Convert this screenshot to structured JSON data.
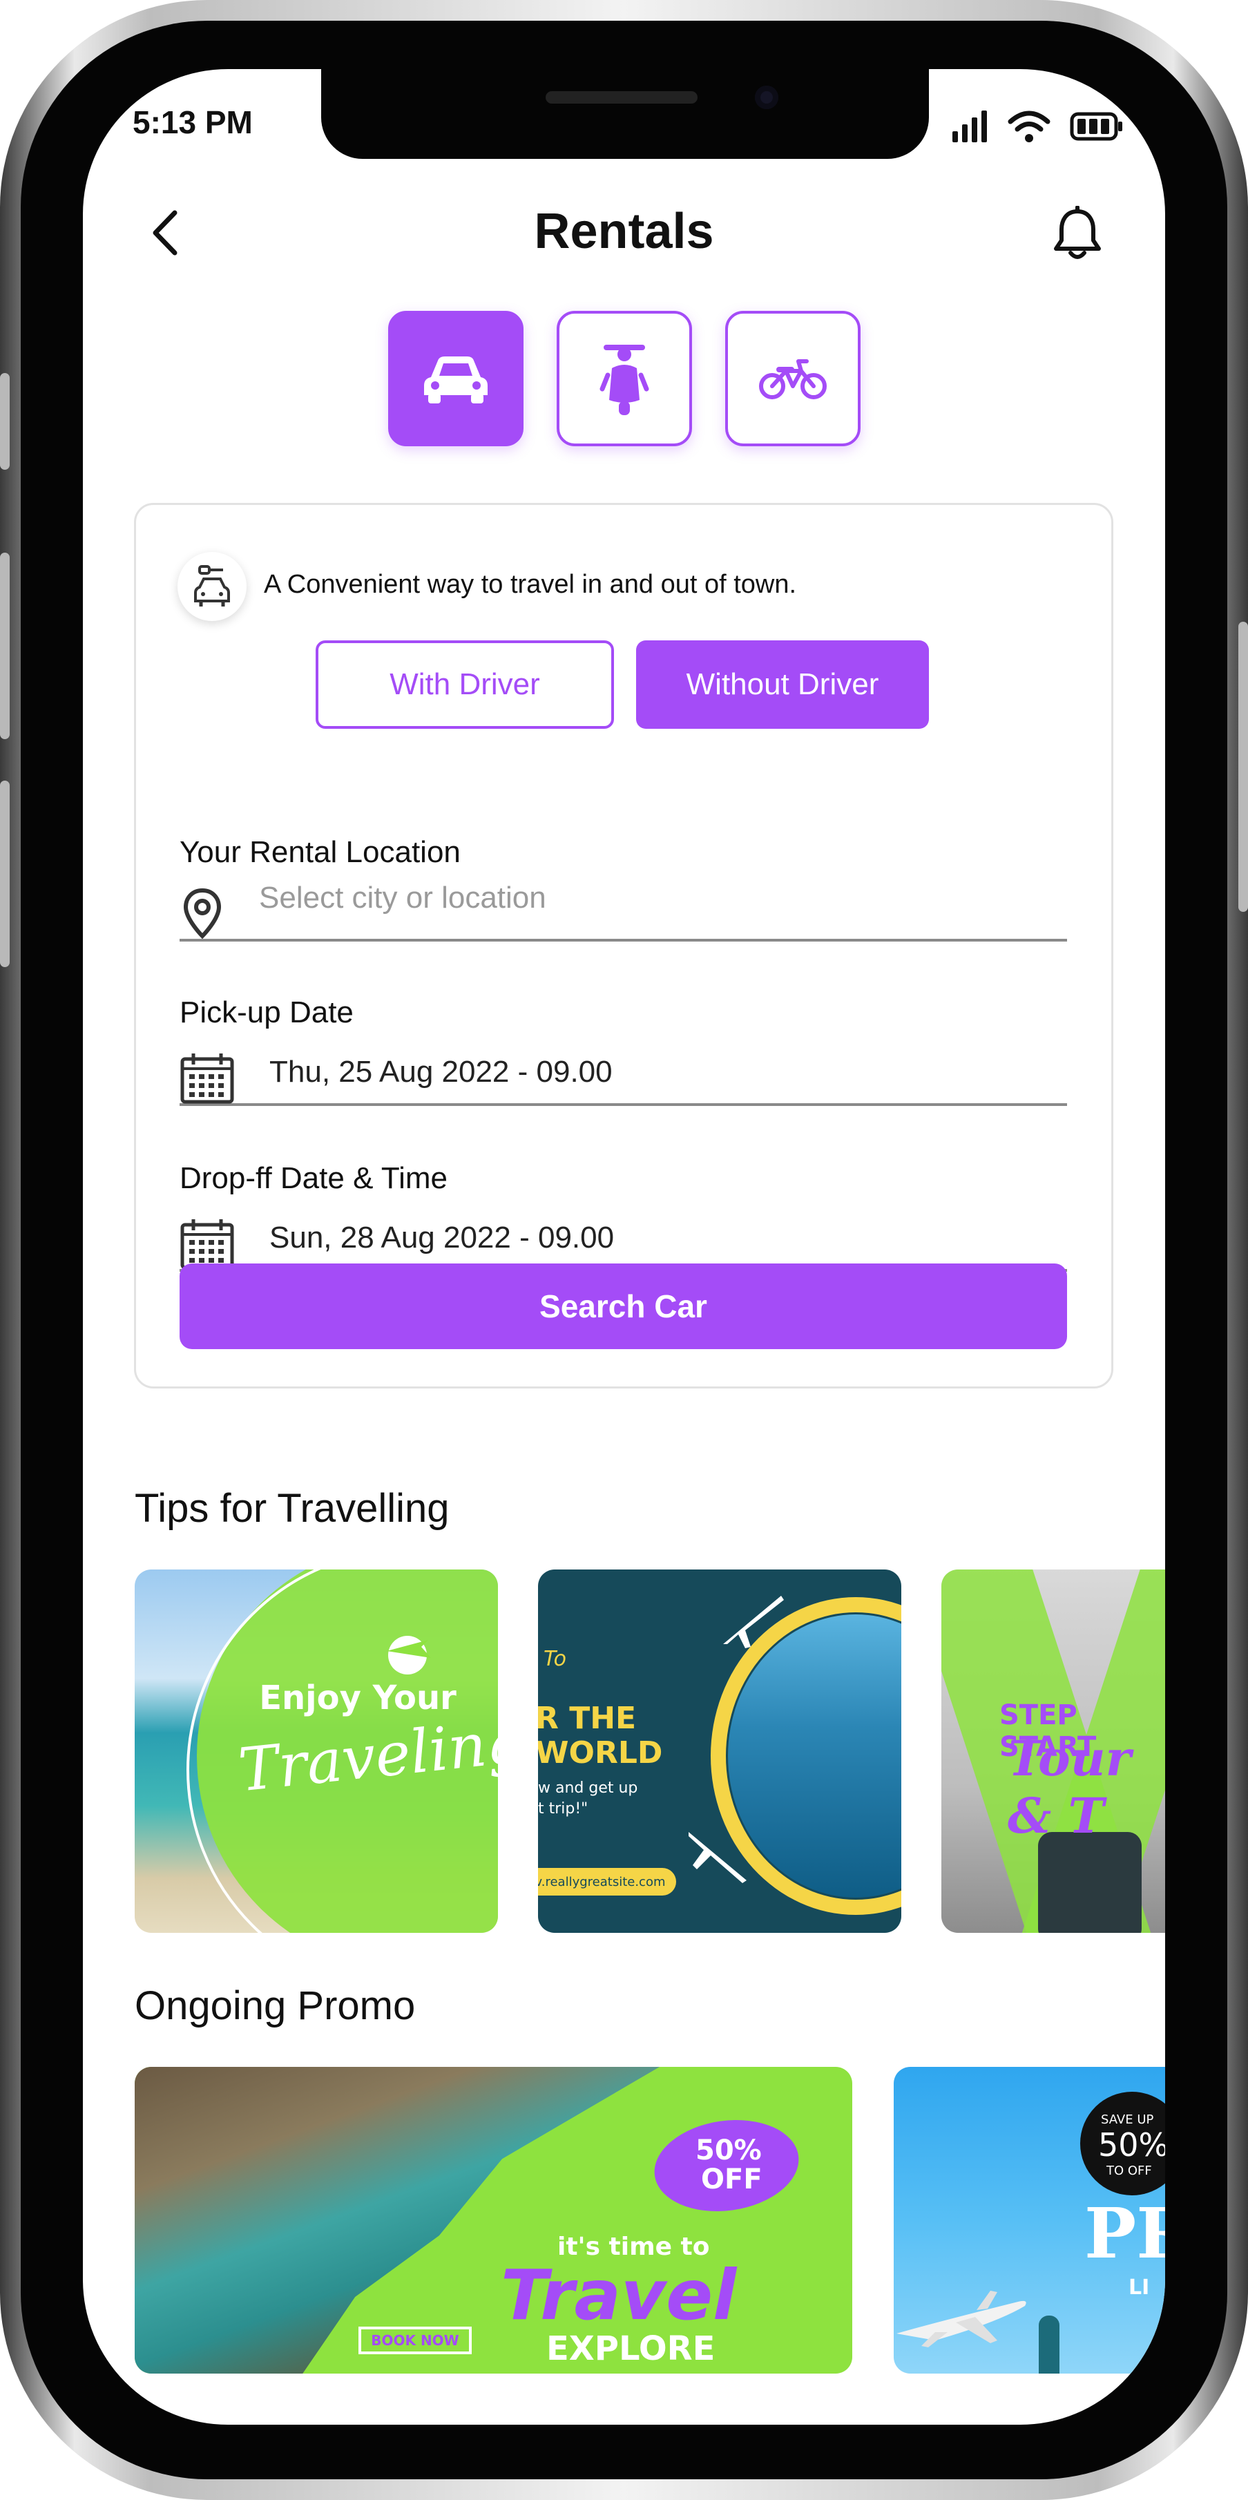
{
  "status_bar": {
    "time": "5:13 PM"
  },
  "header": {
    "title": "Rentals"
  },
  "vehicle_tabs": [
    {
      "name": "car",
      "icon": "car-icon",
      "active": true
    },
    {
      "name": "scooter",
      "icon": "scooter-icon",
      "active": false
    },
    {
      "name": "motorbike",
      "icon": "motorbike-icon",
      "active": false
    }
  ],
  "rental_card": {
    "tagline": "A Convenient way to travel in and out of town.",
    "mode_with_driver": "With Driver",
    "mode_without_driver": "Without Driver",
    "selected_mode": "Without Driver",
    "location_label": "Your Rental Location",
    "location_placeholder": "Select city or location",
    "pickup_label": "Pick-up Date",
    "pickup_value": "Thu, 25 Aug 2022 - 09.00",
    "dropoff_label": "Drop-ff Date & Time",
    "dropoff_value": "Sun, 28 Aug 2022 - 09.00",
    "search_button": "Search Car"
  },
  "tips": {
    "title": "Tips for Travelling",
    "cards": [
      {
        "line1": "Enjoy Your",
        "line2": "Traveling"
      },
      {
        "line0": "To",
        "line1": "R THE",
        "line2": "WORLD",
        "line3": "w and get up",
        "line4": "t trip!\"",
        "url": "v.reallygreatsite.com"
      },
      {
        "line1": "STEP START",
        "line2": "Tour & T"
      }
    ]
  },
  "promo": {
    "title": "Ongoing Promo",
    "cards": [
      {
        "badge_line1": "50%",
        "badge_line2": "OFF",
        "tagline": "it's time to",
        "headline": "Travel",
        "sub": "EXPLORE",
        "cta": "BOOK NOW"
      },
      {
        "badge_line1": "SAVE UP",
        "badge_line2": "50%",
        "badge_line3": "TO OFF",
        "headline": "PR",
        "sub": "LI"
      }
    ]
  },
  "colors": {
    "accent": "#a44cf7",
    "lime": "#8ee23f",
    "navy": "#164a5a"
  }
}
